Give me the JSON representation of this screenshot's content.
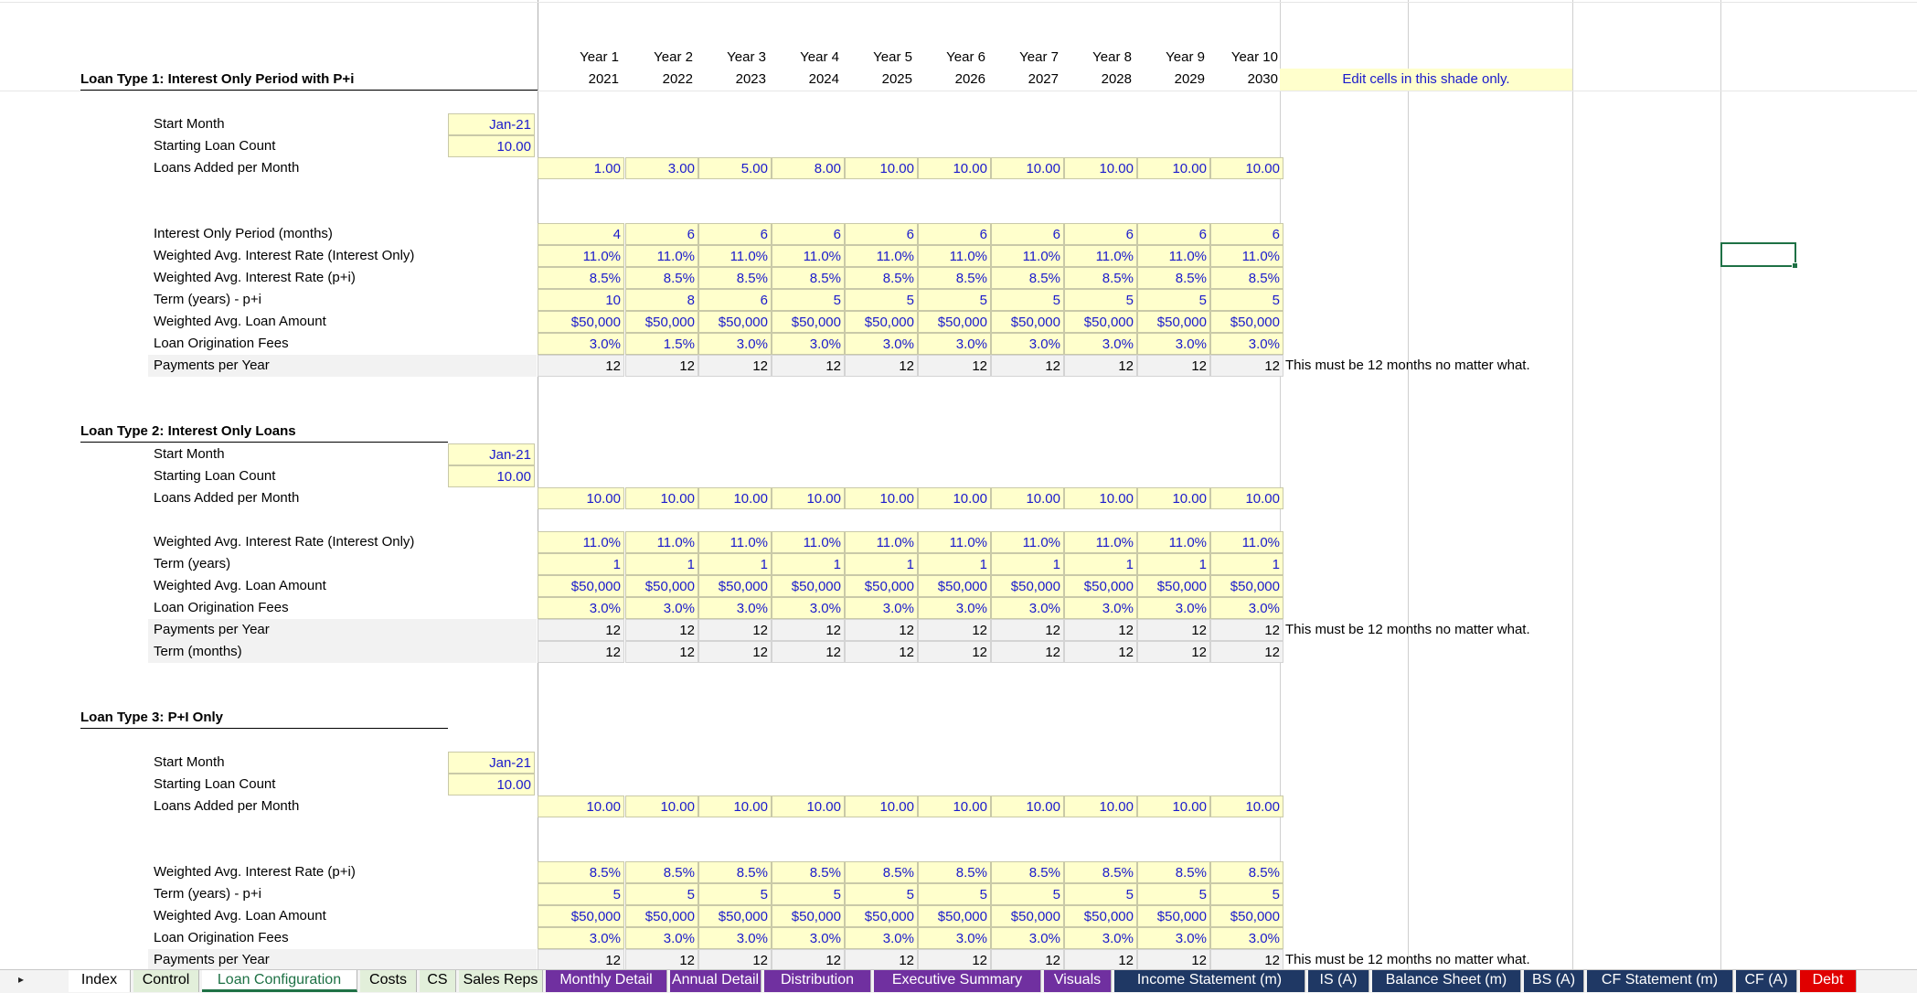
{
  "header": {
    "years": [
      "Year 1",
      "Year 2",
      "Year 3",
      "Year 4",
      "Year 5",
      "Year 6",
      "Year 7",
      "Year 8",
      "Year 9",
      "Year 10"
    ],
    "cal_years": [
      "2021",
      "2022",
      "2023",
      "2024",
      "2025",
      "2026",
      "2027",
      "2028",
      "2029",
      "2030"
    ],
    "edit_note": "Edit cells in this shade only."
  },
  "payments_note": "This must be 12 months no matter what.",
  "loan1": {
    "title": "Loan Type 1: Interest Only Period with P+i",
    "start_month_label": "Start Month",
    "start_month": "Jan-21",
    "starting_count_label": "Starting Loan Count",
    "starting_count": "10.00",
    "added_label": "Loans Added per Month",
    "added": [
      "1.00",
      "3.00",
      "5.00",
      "8.00",
      "10.00",
      "10.00",
      "10.00",
      "10.00",
      "10.00",
      "10.00"
    ],
    "io_period_label": "Interest Only Period (months)",
    "io_period": [
      "4",
      "6",
      "6",
      "6",
      "6",
      "6",
      "6",
      "6",
      "6",
      "6"
    ],
    "rate_io_label": "Weighted Avg. Interest Rate (Interest Only)",
    "rate_io": [
      "11.0%",
      "11.0%",
      "11.0%",
      "11.0%",
      "11.0%",
      "11.0%",
      "11.0%",
      "11.0%",
      "11.0%",
      "11.0%"
    ],
    "rate_pi_label": "Weighted Avg. Interest Rate (p+i)",
    "rate_pi": [
      "8.5%",
      "8.5%",
      "8.5%",
      "8.5%",
      "8.5%",
      "8.5%",
      "8.5%",
      "8.5%",
      "8.5%",
      "8.5%"
    ],
    "term_label": "Term (years) - p+i",
    "term": [
      "10",
      "8",
      "6",
      "5",
      "5",
      "5",
      "5",
      "5",
      "5",
      "5"
    ],
    "amount_label": "Weighted Avg. Loan Amount",
    "amount": [
      "$50,000",
      "$50,000",
      "$50,000",
      "$50,000",
      "$50,000",
      "$50,000",
      "$50,000",
      "$50,000",
      "$50,000",
      "$50,000"
    ],
    "fees_label": "Loan Origination Fees",
    "fees": [
      "3.0%",
      "1.5%",
      "3.0%",
      "3.0%",
      "3.0%",
      "3.0%",
      "3.0%",
      "3.0%",
      "3.0%",
      "3.0%"
    ],
    "ppy_label": "Payments per Year",
    "ppy": [
      "12",
      "12",
      "12",
      "12",
      "12",
      "12",
      "12",
      "12",
      "12",
      "12"
    ]
  },
  "loan2": {
    "title": "Loan Type 2: Interest Only Loans",
    "start_month_label": "Start Month",
    "start_month": "Jan-21",
    "starting_count_label": "Starting Loan Count",
    "starting_count": "10.00",
    "added_label": "Loans Added per Month",
    "added": [
      "10.00",
      "10.00",
      "10.00",
      "10.00",
      "10.00",
      "10.00",
      "10.00",
      "10.00",
      "10.00",
      "10.00"
    ],
    "rate_io_label": "Weighted Avg. Interest Rate (Interest Only)",
    "rate_io": [
      "11.0%",
      "11.0%",
      "11.0%",
      "11.0%",
      "11.0%",
      "11.0%",
      "11.0%",
      "11.0%",
      "11.0%",
      "11.0%"
    ],
    "term_label": "Term (years)",
    "term": [
      "1",
      "1",
      "1",
      "1",
      "1",
      "1",
      "1",
      "1",
      "1",
      "1"
    ],
    "amount_label": "Weighted Avg. Loan Amount",
    "amount": [
      "$50,000",
      "$50,000",
      "$50,000",
      "$50,000",
      "$50,000",
      "$50,000",
      "$50,000",
      "$50,000",
      "$50,000",
      "$50,000"
    ],
    "fees_label": "Loan Origination Fees",
    "fees": [
      "3.0%",
      "3.0%",
      "3.0%",
      "3.0%",
      "3.0%",
      "3.0%",
      "3.0%",
      "3.0%",
      "3.0%",
      "3.0%"
    ],
    "ppy_label": "Payments per Year",
    "ppy": [
      "12",
      "12",
      "12",
      "12",
      "12",
      "12",
      "12",
      "12",
      "12",
      "12"
    ],
    "term_months_label": "Term (months)",
    "term_months": [
      "12",
      "12",
      "12",
      "12",
      "12",
      "12",
      "12",
      "12",
      "12",
      "12"
    ]
  },
  "loan3": {
    "title": "Loan Type 3: P+I Only",
    "start_month_label": "Start Month",
    "start_month": "Jan-21",
    "starting_count_label": "Starting Loan Count",
    "starting_count": "10.00",
    "added_label": "Loans Added per Month",
    "added": [
      "10.00",
      "10.00",
      "10.00",
      "10.00",
      "10.00",
      "10.00",
      "10.00",
      "10.00",
      "10.00",
      "10.00"
    ],
    "rate_pi_label": "Weighted Avg. Interest Rate (p+i)",
    "rate_pi": [
      "8.5%",
      "8.5%",
      "8.5%",
      "8.5%",
      "8.5%",
      "8.5%",
      "8.5%",
      "8.5%",
      "8.5%",
      "8.5%"
    ],
    "term_label": "Term (years) - p+i",
    "term": [
      "5",
      "5",
      "5",
      "5",
      "5",
      "5",
      "5",
      "5",
      "5",
      "5"
    ],
    "amount_label": "Weighted Avg. Loan Amount",
    "amount": [
      "$50,000",
      "$50,000",
      "$50,000",
      "$50,000",
      "$50,000",
      "$50,000",
      "$50,000",
      "$50,000",
      "$50,000",
      "$50,000"
    ],
    "fees_label": "Loan Origination Fees",
    "fees": [
      "3.0%",
      "3.0%",
      "3.0%",
      "3.0%",
      "3.0%",
      "3.0%",
      "3.0%",
      "3.0%",
      "3.0%",
      "3.0%"
    ],
    "ppy_label": "Payments per Year",
    "ppy": [
      "12",
      "12",
      "12",
      "12",
      "12",
      "12",
      "12",
      "12",
      "12",
      "12"
    ]
  },
  "tabs": [
    {
      "label": "Index",
      "bg": "#ffffff",
      "fg": "#000000",
      "active": false
    },
    {
      "label": "Control",
      "bg": "#e2efda",
      "fg": "#000000",
      "active": false
    },
    {
      "label": "Loan Configuration",
      "bg": "#ffffff",
      "fg": "#1e7145",
      "active": true
    },
    {
      "label": "Costs",
      "bg": "#e2efda",
      "fg": "#000000",
      "active": false
    },
    {
      "label": "CS",
      "bg": "#e2efda",
      "fg": "#000000",
      "active": false
    },
    {
      "label": "Sales Reps",
      "bg": "#e2efda",
      "fg": "#000000",
      "active": false
    },
    {
      "label": "Monthly Detail",
      "bg": "#7030a0",
      "fg": "#ffffff",
      "active": false
    },
    {
      "label": "Annual Detail",
      "bg": "#7030a0",
      "fg": "#ffffff",
      "active": false
    },
    {
      "label": "Distribution",
      "bg": "#7030a0",
      "fg": "#ffffff",
      "active": false
    },
    {
      "label": "Executive Summary",
      "bg": "#7030a0",
      "fg": "#ffffff",
      "active": false
    },
    {
      "label": "Visuals",
      "bg": "#7030a0",
      "fg": "#ffffff",
      "active": false
    },
    {
      "label": "Income Statement (m)",
      "bg": "#1f3864",
      "fg": "#ffffff",
      "active": false
    },
    {
      "label": "IS (A)",
      "bg": "#1f3864",
      "fg": "#ffffff",
      "active": false
    },
    {
      "label": "Balance Sheet (m)",
      "bg": "#1f3864",
      "fg": "#ffffff",
      "active": false
    },
    {
      "label": "BS (A)",
      "bg": "#1f3864",
      "fg": "#ffffff",
      "active": false
    },
    {
      "label": "CF Statement (m)",
      "bg": "#1f3864",
      "fg": "#ffffff",
      "active": false
    },
    {
      "label": "CF (A)",
      "bg": "#1f3864",
      "fg": "#ffffff",
      "active": false
    },
    {
      "label": "Debt",
      "bg": "#e00000",
      "fg": "#ffffff",
      "active": false
    }
  ],
  "colors": {
    "input_fill": "#ffffcc",
    "input_text": "#1a1acc",
    "active_tab": "#1e7145"
  }
}
